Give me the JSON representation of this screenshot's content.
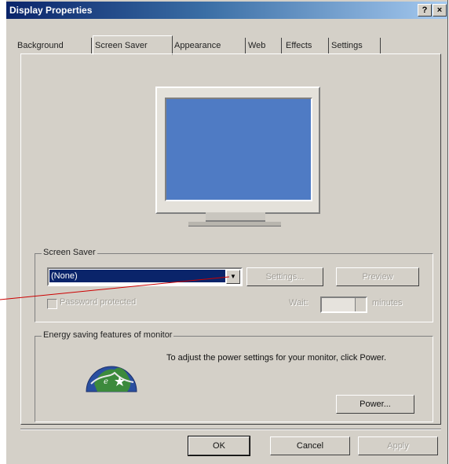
{
  "window": {
    "title": "Display Properties",
    "help_glyph": "?",
    "close_glyph": "×"
  },
  "tabs": [
    {
      "label": "Background"
    },
    {
      "label": "Screen Saver"
    },
    {
      "label": "Appearance"
    },
    {
      "label": "Web"
    },
    {
      "label": "Effects"
    },
    {
      "label": "Settings"
    }
  ],
  "screen_saver": {
    "group_label": "Screen Saver",
    "selected": "(None)",
    "settings_label": "Settings...",
    "preview_label": "Preview",
    "password_label": "Password protected",
    "wait_label": "Wait:",
    "wait_value": "",
    "minutes_label": "minutes"
  },
  "energy": {
    "group_label": "Energy saving features of monitor",
    "text": "To adjust the power settings for your monitor, click Power.",
    "power_label": "Power..."
  },
  "footer": {
    "ok_label": "OK",
    "cancel_label": "Cancel",
    "apply_label": "Apply"
  },
  "colors": {
    "title_gradient_start": "#0a246a",
    "dialog_bg": "#d4d0c8",
    "selection": "#0a246a",
    "annotation_line": "#cc0000"
  }
}
